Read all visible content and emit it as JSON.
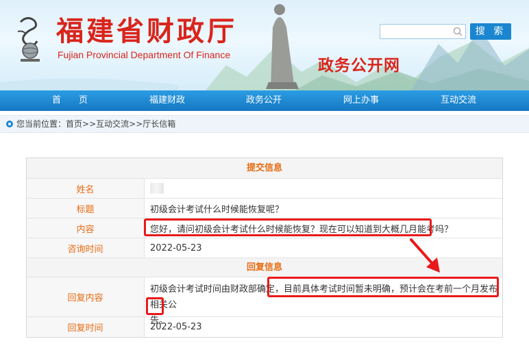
{
  "header": {
    "title_cn": "福建省财政厅",
    "title_en": "Fujian Provincial Department Of Finance",
    "portal_name": "政务公开网",
    "search": {
      "placeholder": "",
      "value": "",
      "button_label": "搜 索"
    }
  },
  "nav": {
    "items": [
      {
        "label": "首　　页"
      },
      {
        "label": "福建财政"
      },
      {
        "label": "政务公开"
      },
      {
        "label": "网上办事"
      },
      {
        "label": "互动交流"
      }
    ]
  },
  "breadcrumb": {
    "prefix": "您当前位置：",
    "items": [
      "首页",
      "互动交流",
      "厅长信箱"
    ],
    "separator": ">>"
  },
  "submission": {
    "section_title": "提交信息",
    "name_label": "姓名",
    "name_value": "",
    "subject_label": "标题",
    "subject_value": "初级会计考试什么时候能恢复呢？",
    "content_label": "内容",
    "content_value": "您好，请问初级会计考试什么时候能恢复？现在可以知道到大概几月能考吗？",
    "time_label": "咨询时间",
    "time_value": "2022-05-23"
  },
  "reply": {
    "section_title": "回复信息",
    "content_label": "回复内容",
    "content_part1": "初级会计考试时间由财政部确定，",
    "content_part2": "目前具体考试时间暂未明确，预计会在考前一个月发布相关公",
    "content_part3": "告。",
    "time_label": "回复时间",
    "time_value": "2022-05-23"
  },
  "colors": {
    "brand_red": "#d9251c",
    "nav_blue": "#1a86d0",
    "label_orange": "#e86a10",
    "highlight_red": "#e8191a"
  }
}
